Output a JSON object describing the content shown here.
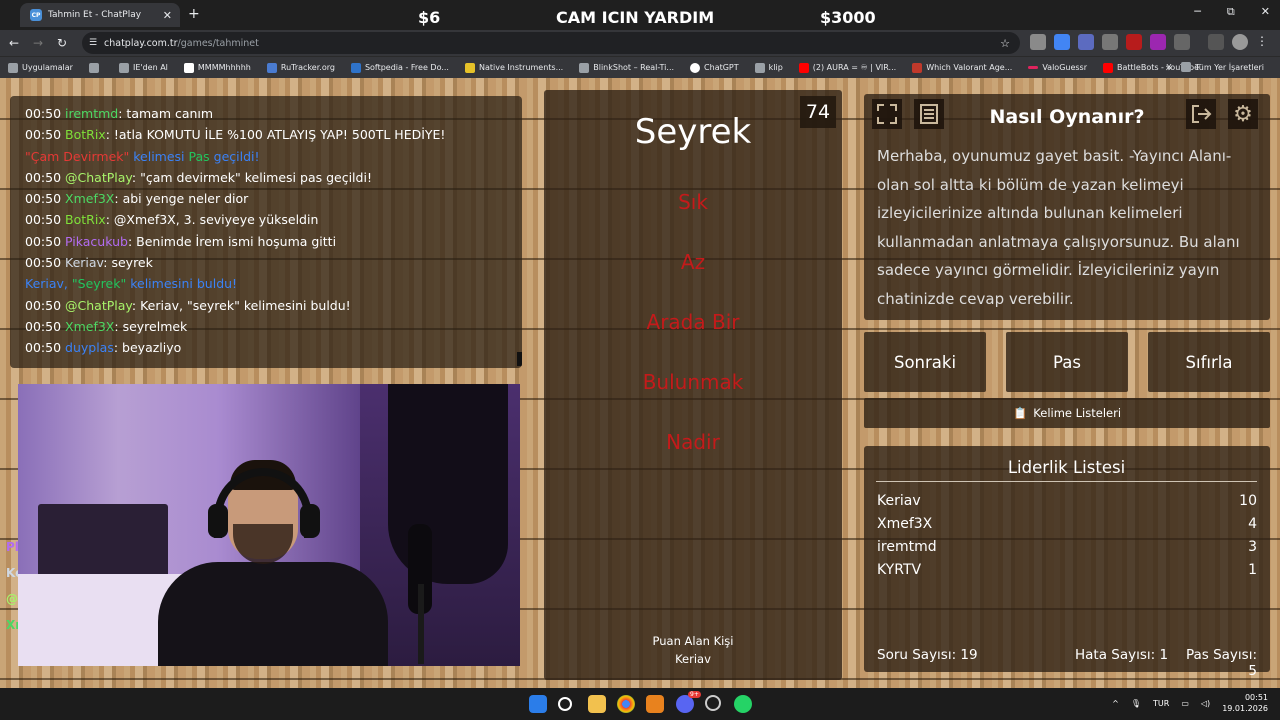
{
  "browser": {
    "tab_title": "Tahmin Et - ChatPlay",
    "tab_favicon": "CP",
    "url_domain": "chatplay.com.tr",
    "url_path": "/games/tahminet",
    "new_tab": "+",
    "win_min": "─",
    "win_max": "⧉",
    "win_close": "✕"
  },
  "stream_overlay": {
    "left": "$6",
    "center": "CAM ICIN YARDIM",
    "right": "$3000"
  },
  "bookmarks": [
    {
      "label": "Uygulamalar",
      "color": "#9aa0a6"
    },
    {
      "label": "",
      "color": "#9aa0a6"
    },
    {
      "label": "IE'den Al",
      "color": "#9aa0a6"
    },
    {
      "label": "MMMMhhhhh",
      "color": "#ffffff"
    },
    {
      "label": "RuTracker.org",
      "color": "#4a7bd0"
    },
    {
      "label": "Softpedia - Free Do...",
      "color": "#2f73c9"
    },
    {
      "label": "Native Instruments...",
      "color": "#e6c229"
    },
    {
      "label": "BlinkShot – Real-Ti...",
      "color": "#9aa0a6"
    },
    {
      "label": "ChatGPT",
      "color": "#ffffff"
    },
    {
      "label": "klip",
      "color": "#9aa0a6"
    },
    {
      "label": "(2) AURA = ♾ | VIR...",
      "color": "#ff0000"
    },
    {
      "label": "Which Valorant Age...",
      "color": "#c0392b"
    },
    {
      "label": "ValoGuessr",
      "color": "#e0245e"
    },
    {
      "label": "BattleBots - YouTube",
      "color": "#ff0000"
    }
  ],
  "bookmarks_more": "»",
  "bookmarks_all": "Tüm Yer İşaretleri",
  "chat": [
    {
      "time": "00:50",
      "user": "iremtmd",
      "user_color": "#4cd964",
      "sep": ": ",
      "msg": "tamam canım",
      "msg_color": "#ffffff"
    },
    {
      "time": "00:50",
      "user": "BotRix",
      "user_color": "#7fe03a",
      "sep": ": ",
      "msg": "!atla KOMUTU İLE %100 ATLAYIŞ YAP! 500TL HEDİYE!",
      "msg_color": "#ffffff"
    },
    {
      "time": "",
      "user": "\"Çam Devirmek\"",
      "user_color": "#e53935",
      "sep": " ",
      "msg": "kelimesi",
      "msg_color": "#3b82f6",
      "extra": " Pas",
      "extra_color": "#22c55e",
      "tail": " geçildi!",
      "tail_color": "#3b82f6"
    },
    {
      "time": "00:50",
      "user": "@ChatPlay",
      "user_color": "#a7f36a",
      "sep": ": ",
      "msg": "\"çam devirmek\" kelimesi pas geçildi!",
      "msg_color": "#ffffff"
    },
    {
      "time": "00:50",
      "user": "Xmef3X",
      "user_color": "#4cd964",
      "sep": ": ",
      "msg": "abi yenge neler dior",
      "msg_color": "#ffffff"
    },
    {
      "time": "00:50",
      "user": "BotRix",
      "user_color": "#7fe03a",
      "sep": ": ",
      "msg": "@Xmef3X, 3. seviyeye yükseldin",
      "msg_color": "#ffffff"
    },
    {
      "time": "00:50",
      "user": "Pikacukub",
      "user_color": "#b26cf0",
      "sep": ": ",
      "msg": "Benimde İrem ismi hoşuma gitti",
      "msg_color": "#ffffff"
    },
    {
      "time": "00:50",
      "user": "Keriav",
      "user_color": "#cfd8e3",
      "sep": ": ",
      "msg": "seyrek",
      "msg_color": "#ffffff"
    },
    {
      "time": "",
      "user": "Keriav,",
      "user_color": "#3b82f6",
      "sep": " ",
      "msg": "\"Seyrek\"",
      "msg_color": "#22c55e",
      "extra": " kelimesini buldu!",
      "extra_color": "#3b82f6",
      "tail": "",
      "tail_color": "#ffffff"
    },
    {
      "time": "00:50",
      "user": "@ChatPlay",
      "user_color": "#a7f36a",
      "sep": ": ",
      "msg": "Keriav, \"seyrek\" kelimesini buldu!",
      "msg_color": "#ffffff"
    },
    {
      "time": "00:50",
      "user": "Xmef3X",
      "user_color": "#4cd964",
      "sep": ": ",
      "msg": "seyrelmek",
      "msg_color": "#ffffff"
    },
    {
      "time": "00:50",
      "user": "duyplas",
      "user_color": "#3b82f6",
      "sep": ": ",
      "msg": "beyazliyo",
      "msg_color": "#ffffff"
    }
  ],
  "peek_chat": [
    {
      "text": "Pl",
      "color": "#b26cf0"
    },
    {
      "text": "Ke",
      "color": "#cfd8e3"
    },
    {
      "text": "@",
      "color": "#a7f36a"
    },
    {
      "text": "Xı",
      "color": "#4cd964"
    }
  ],
  "game": {
    "counter": "74",
    "word": "Seyrek",
    "forbidden": [
      "Sık",
      "Az",
      "Arada Bir",
      "Bulunmak",
      "Nadir"
    ],
    "scorer_label": "Puan Alan Kişi",
    "scorer_name": "Keriav"
  },
  "howto": {
    "title": "Nasıl Oynanır?",
    "text": "Merhaba, oyunumuz gayet basit. -Yayıncı Alanı- olan sol altta ki bölüm de yazan kelimeyi izleyicilerinize altında bulunan kelimeleri kullanmadan anlatmaya çalışıyorsunuz. Bu alanı sadece yayıncı görmelidir. İzleyicileriniz yayın chatinizde cevap verebilir."
  },
  "buttons": {
    "next": "Sonraki",
    "pass": "Pas",
    "reset": "Sıfırla",
    "word_lists": "Kelime Listeleri"
  },
  "leaderboard": {
    "title": "Liderlik Listesi",
    "rows": [
      {
        "name": "Keriav",
        "score": "10"
      },
      {
        "name": "Xmef3X",
        "score": "4"
      },
      {
        "name": "iremtmd",
        "score": "3"
      },
      {
        "name": "KYRTV",
        "score": "1"
      }
    ],
    "questions": "Soru Sayısı: 19",
    "errors": "Hata Sayısı: 1",
    "passes": "Pas Sayısı: 5"
  },
  "taskbar": {
    "lang": "TUR",
    "time": "00:51",
    "date": "19.01.2026",
    "badge": "9+"
  }
}
